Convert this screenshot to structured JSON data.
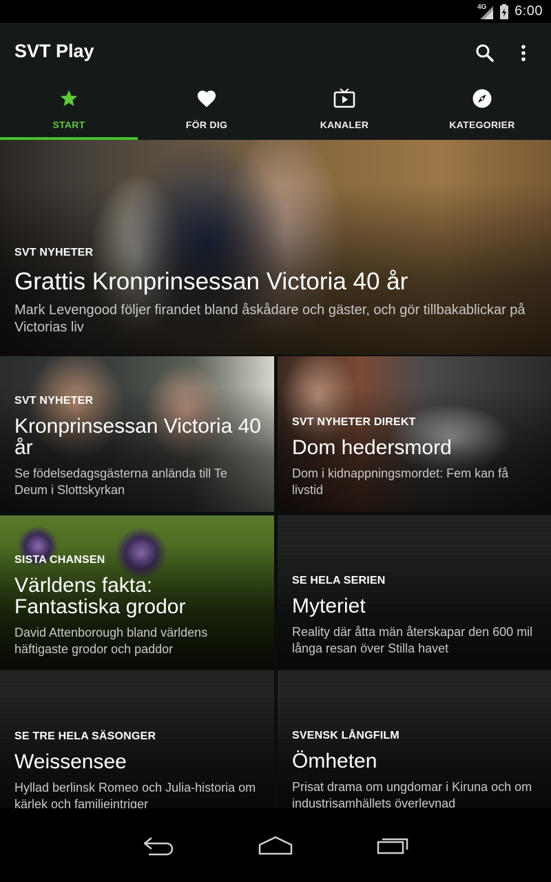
{
  "status_bar": {
    "network": "4G",
    "time": "6:00"
  },
  "app_bar": {
    "title": "SVT Play",
    "actions": [
      {
        "icon": "search-icon"
      },
      {
        "icon": "more-vert-icon"
      }
    ]
  },
  "tabs": [
    {
      "label": "START",
      "icon": "star-icon",
      "active": true
    },
    {
      "label": "FÖR DIG",
      "icon": "heart-icon",
      "active": false
    },
    {
      "label": "KANALER",
      "icon": "tv-icon",
      "active": false
    },
    {
      "label": "KATEGORIER",
      "icon": "compass-icon",
      "active": false
    }
  ],
  "colors": {
    "accent": "#43c42c",
    "appbar_bg": "#15191a"
  },
  "tiles": [
    {
      "kicker": "SVT NYHETER",
      "title": "Grattis Kronprinsessan Victoria 40 år",
      "description": "Mark Levengood följer firandet bland åskådare och gäster, och gör tillbakablickar på Victorias liv"
    },
    {
      "kicker": "SVT NYHETER",
      "title": "Kronprinsessan Victoria 40 år",
      "description": "Se födelsedagsgästerna anlända till Te Deum i Slottskyrkan"
    },
    {
      "kicker": "SVT NYHETER DIREKT",
      "title": "Dom hedersmord",
      "description": "Dom i kidnappningsmordet: Fem kan få livstid"
    },
    {
      "kicker": "SISTA CHANSEN",
      "title": "Världens fakta: Fantastiska grodor",
      "description": "David Attenborough bland världens häftigaste grodor och paddor"
    },
    {
      "kicker": "SE HELA SERIEN",
      "title": "Myteriet",
      "description": "Reality där åtta män återskapar den 600 mil långa resan över Stilla havet"
    },
    {
      "kicker": "SE TRE HELA SÄSONGER",
      "title": "Weissensee",
      "description": "Hyllad berlinsk Romeo och Julia-historia om kärlek och familjeintriger"
    },
    {
      "kicker": "SVENSK LÅNGFILM",
      "title": "Ömheten",
      "description": "Prisat drama om ungdomar i Kiruna och om industrisamhällets överlevnad"
    }
  ],
  "nav_bar": {
    "buttons": [
      "back-icon",
      "home-icon",
      "recents-icon"
    ]
  }
}
